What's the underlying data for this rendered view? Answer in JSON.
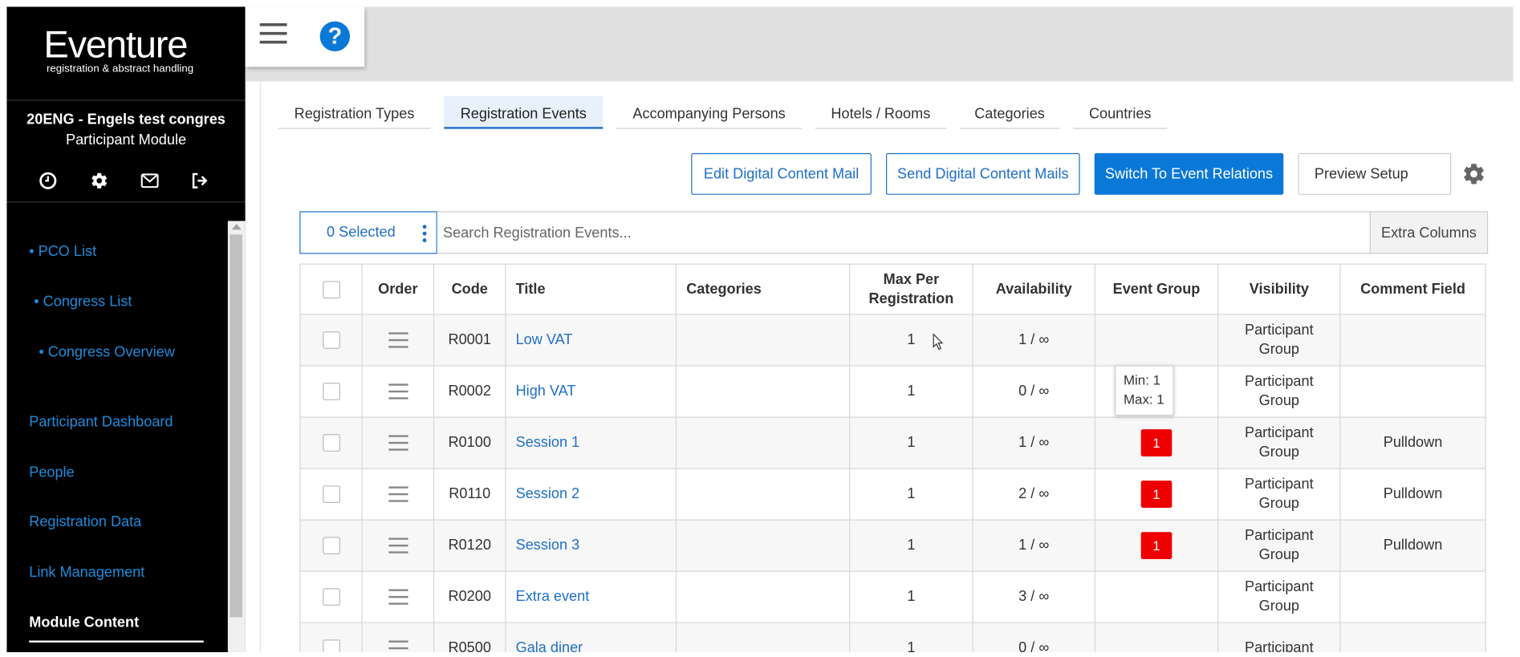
{
  "sidebar": {
    "logo_main": "Eventure",
    "logo_sub": "registration & abstract handling",
    "congress_name": "20ENG - Engels test congres",
    "module_name": "Participant Module",
    "icons": [
      "clock-icon",
      "gear-icon",
      "mail-icon",
      "logout-icon"
    ],
    "items": [
      {
        "label": "• PCO List"
      },
      {
        "label": "• Congress List"
      },
      {
        "label": "• Congress Overview"
      },
      {
        "label": "Participant Dashboard"
      },
      {
        "label": "People"
      },
      {
        "label": "Registration Data"
      },
      {
        "label": "Link Management"
      },
      {
        "label": "Module Content"
      }
    ]
  },
  "toolbar": {
    "help_label": "?"
  },
  "tabs": [
    {
      "label": "Registration Types"
    },
    {
      "label": "Registration Events",
      "active": true
    },
    {
      "label": "Accompanying Persons"
    },
    {
      "label": "Hotels / Rooms"
    },
    {
      "label": "Categories"
    },
    {
      "label": "Countries"
    }
  ],
  "actions": {
    "edit_mail": "Edit Digital Content Mail",
    "send_mails": "Send Digital Content Mails",
    "switch_relations": "Switch To Event Relations",
    "preview_setup": "Preview Setup"
  },
  "search": {
    "selected": "0 Selected",
    "placeholder": "Search Registration Events...",
    "extra_columns": "Extra Columns"
  },
  "table": {
    "headers": {
      "order": "Order",
      "code": "Code",
      "title": "Title",
      "categories": "Categories",
      "max_per_registration_1": "Max Per",
      "max_per_registration_2": "Registration",
      "availability": "Availability",
      "event_group": "Event Group",
      "visibility": "Visibility",
      "comment_field": "Comment Field"
    },
    "rows": [
      {
        "code": "R0001",
        "title": "Low VAT",
        "categories": "",
        "max": "1",
        "availability": "1 / ∞",
        "event_group": "",
        "visibility_1": "Participant",
        "visibility_2": "Group",
        "comment": ""
      },
      {
        "code": "R0002",
        "title": "High VAT",
        "categories": "",
        "max": "1",
        "availability": "0 / ∞",
        "event_group": "",
        "visibility_1": "Participant",
        "visibility_2": "Group",
        "comment": ""
      },
      {
        "code": "R0100",
        "title": "Session 1",
        "categories": "",
        "max": "1",
        "availability": "1 / ∞",
        "event_group": "1",
        "visibility_1": "Participant",
        "visibility_2": "Group",
        "comment": "Pulldown"
      },
      {
        "code": "R0110",
        "title": "Session 2",
        "categories": "",
        "max": "1",
        "availability": "2 / ∞",
        "event_group": "1",
        "visibility_1": "Participant",
        "visibility_2": "Group",
        "comment": "Pulldown"
      },
      {
        "code": "R0120",
        "title": "Session 3",
        "categories": "",
        "max": "1",
        "availability": "1 / ∞",
        "event_group": "1",
        "visibility_1": "Participant",
        "visibility_2": "Group",
        "comment": "Pulldown"
      },
      {
        "code": "R0200",
        "title": "Extra event",
        "categories": "",
        "max": "1",
        "availability": "3 / ∞",
        "event_group": "",
        "visibility_1": "Participant",
        "visibility_2": "Group",
        "comment": ""
      },
      {
        "code": "R0500",
        "title": "Gala diner",
        "categories": "",
        "max": "1",
        "availability": "0 / ∞",
        "event_group": "",
        "visibility_1": "Participant",
        "visibility_2": "",
        "comment": ""
      }
    ]
  },
  "tooltip": {
    "min": "Min: 1",
    "max": "Max: 1"
  },
  "colors": {
    "accent": "#0a78d7",
    "link": "#1e8cdc",
    "badge": "#ee0000",
    "sidebar_bg": "#000000"
  }
}
